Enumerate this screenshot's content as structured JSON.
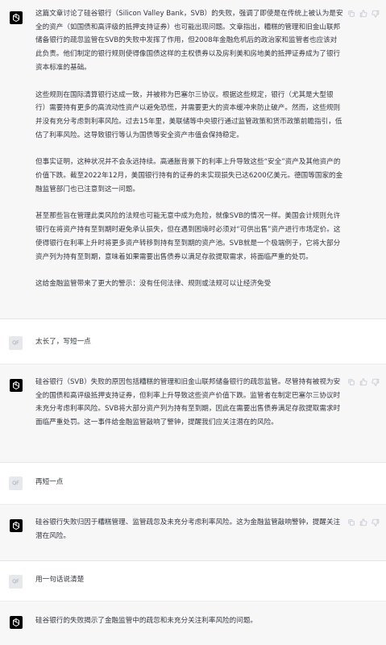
{
  "conversation": {
    "assistant_1": {
      "paragraphs": [
        "这篇文章讨论了硅谷银行（Silicon Valley Bank，SVB）的失败，强调了即使是在传统上被认为是安全的资产（如国债和高评级的抵押支持证券）也可能出现问题。文章指出，糟糕的管理和旧金山联邦储备银行的疏忽监管在SVB的失败中发挥了作用，但2008年金融危机后的政治家和监管者也应该对此负责。他们制定的银行规则使得像国债这样的主权债券以及房利美和房地美的抵押证券成为了银行资本标准的基础。",
        "这些规则在国际清算银行达成一致，并被称为巴塞尔三协议。根据这些规定，银行（尤其是大型银行）需要持有更多的高流动性资产以避免恐慌，并需要更大的资本缓冲来防止破产。然而，这些规则并没有充分考虑到利率风险。过去15年里，美联储等中央银行通过监管政策和货币政策前瞻指引，低估了利率风险。这导致银行等认为国债等安全资产市值会保持稳定。",
        "但事实证明，这种状况并不会永远持续。高通胀背景下的利率上升导致这些“安全”资产及其他资产的价值下跌。截至2022年12月，美国银行持有的证券的未实现损失已达6200亿美元。德国等国家的金融监管部门也已注意到这一问题。",
        "甚至那些旨在管理此类风险的法规也可能无意中成为危险，就像SVB的情况一样。美国会计规则允许银行在将资产持有至到期时避免承认损失，但在遇到困境时必须对“可供出售”资产进行市场定价。这使得银行在利率上升时将更多资产转移到持有至到期的资产池。SVB就是一个极端例子，它将大部分资产列为持有至到期，意味着如果需要出售债券以满足存款提取需求，将面临严重的处罚。",
        "这给金融监管带来了更大的警示：没有任何法律、规则或法规可以让经济免受"
      ]
    },
    "user_1": {
      "avatar": "QF",
      "text": "太长了，写短一点"
    },
    "assistant_2": {
      "paragraphs": [
        "硅谷银行（SVB）失败的原因包括糟糕的管理和旧金山联邦储备银行的疏忽监管。尽管持有被视为安全的国债和高评级抵押支持证券，但利率上升导致这些资产价值下跌。监管者在制定巴塞尔三协议时未充分考虑利率风险。SVB将大部分资产列为持有至到期，因此在需要出售债券满足存款提取需求时面临严重处罚。这一事件给金融监管敲响了警钟，提醒我们应关注潜在的风险。"
      ]
    },
    "user_2": {
      "avatar": "QF",
      "text": "再短一点"
    },
    "assistant_3": {
      "paragraphs": [
        "硅谷银行失败归因于糟糕管理、监管疏忽及未充分考虑利率风险。这为金融监管敲响警钟，提醒关注潜在风险。"
      ]
    },
    "user_3": {
      "avatar": "QF",
      "text": "用一句话说清楚"
    },
    "assistant_4": {
      "paragraphs": [
        "硅谷银行的失败揭示了金融监管中的疏忽和未充分关注利率风险的问题。"
      ]
    }
  },
  "icons": {
    "assistant_avatar": "openai-logo-icon",
    "thumb_up": "thumbs-up-icon",
    "thumb_down": "thumbs-down-icon",
    "copy": "copy-icon"
  },
  "colors": {
    "assistant_bg": "#f7f7f8",
    "user_bg": "#ffffff",
    "text": "#353740",
    "avatar_user_bg": "#e6e8ec"
  }
}
